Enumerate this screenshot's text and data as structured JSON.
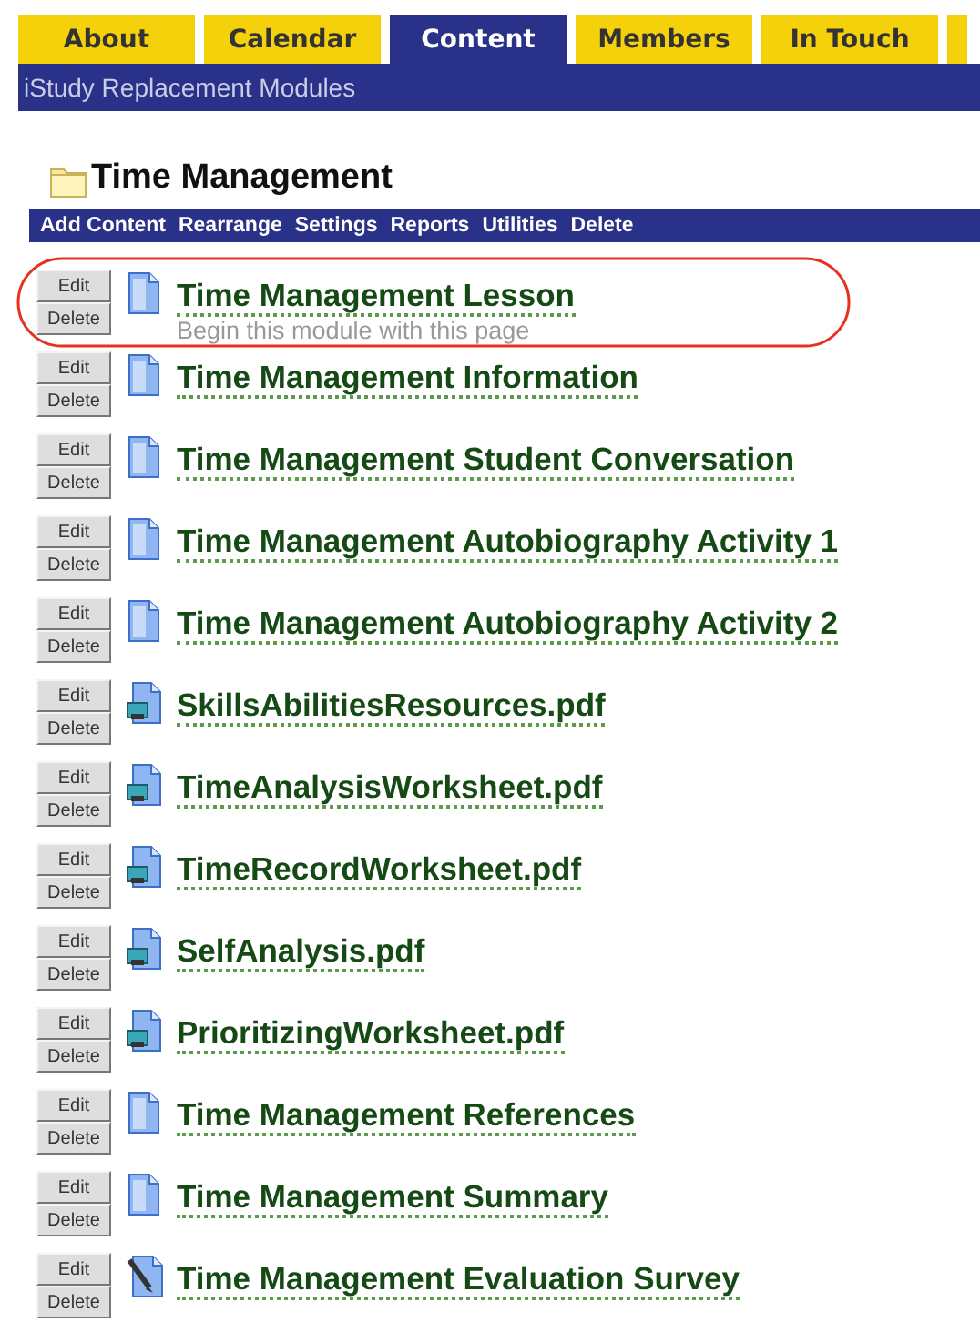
{
  "tabs": [
    {
      "label": "About",
      "selected": false
    },
    {
      "label": "Calendar",
      "selected": false
    },
    {
      "label": "Content",
      "selected": true
    },
    {
      "label": "Members",
      "selected": false
    },
    {
      "label": "In Touch",
      "selected": false
    },
    {
      "selected": false
    }
  ],
  "breadcrumb": "iStudy Replacement Modules",
  "folder": {
    "title": "Time Management"
  },
  "toolbar": [
    "Add Content",
    "Rearrange",
    "Settings",
    "Reports",
    "Utilities",
    "Delete"
  ],
  "items": [
    {
      "kind": "page",
      "title": "Time Management Lesson",
      "description": "Begin this module with this page",
      "circled": true,
      "edit": "Edit",
      "delete": "Delete"
    },
    {
      "kind": "page",
      "title": "Time Management Information",
      "circled": false,
      "edit": "Edit",
      "delete": "Delete"
    },
    {
      "kind": "page",
      "title": "Time Management Student Conversation",
      "circled": false,
      "edit": "Edit",
      "delete": "Delete"
    },
    {
      "kind": "page",
      "title": "Time Management Autobiography Activity 1",
      "circled": false,
      "edit": "Edit",
      "delete": "Delete"
    },
    {
      "kind": "page",
      "title": "Time Management Autobiography Activity 2",
      "circled": false,
      "edit": "Edit",
      "delete": "Delete"
    },
    {
      "kind": "file",
      "title": "SkillsAbilitiesResources.pdf",
      "circled": false,
      "edit": "Edit",
      "delete": "Delete"
    },
    {
      "kind": "file",
      "title": "TimeAnalysisWorksheet.pdf",
      "circled": false,
      "edit": "Edit",
      "delete": "Delete"
    },
    {
      "kind": "file",
      "title": "TimeRecordWorksheet.pdf",
      "circled": false,
      "edit": "Edit",
      "delete": "Delete"
    },
    {
      "kind": "file",
      "title": "SelfAnalysis.pdf",
      "circled": false,
      "edit": "Edit",
      "delete": "Delete"
    },
    {
      "kind": "file",
      "title": "PrioritizingWorksheet.pdf",
      "circled": false,
      "edit": "Edit",
      "delete": "Delete"
    },
    {
      "kind": "page",
      "title": "Time Management References",
      "circled": false,
      "edit": "Edit",
      "delete": "Delete"
    },
    {
      "kind": "page",
      "title": "Time Management Summary",
      "circled": false,
      "edit": "Edit",
      "delete": "Delete"
    },
    {
      "kind": "survey",
      "title": "Time Management Evaluation Survey",
      "circled": false,
      "edit": "Edit",
      "delete": "Delete"
    }
  ]
}
